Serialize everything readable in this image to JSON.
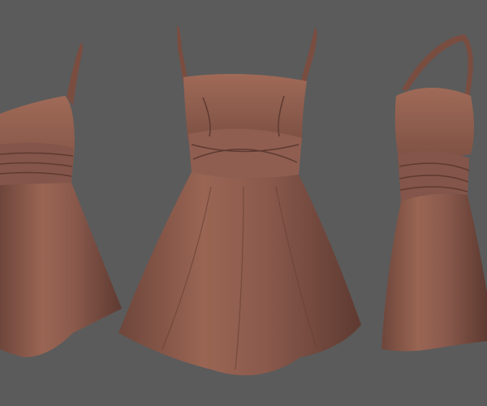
{
  "colors": {
    "background": "#5b5b5b",
    "dress_base": "#8b5a4d",
    "dress_shadow": "#5e3a31",
    "dress_highlight": "#a8735f"
  },
  "views": [
    "side-left",
    "front",
    "side-right"
  ]
}
